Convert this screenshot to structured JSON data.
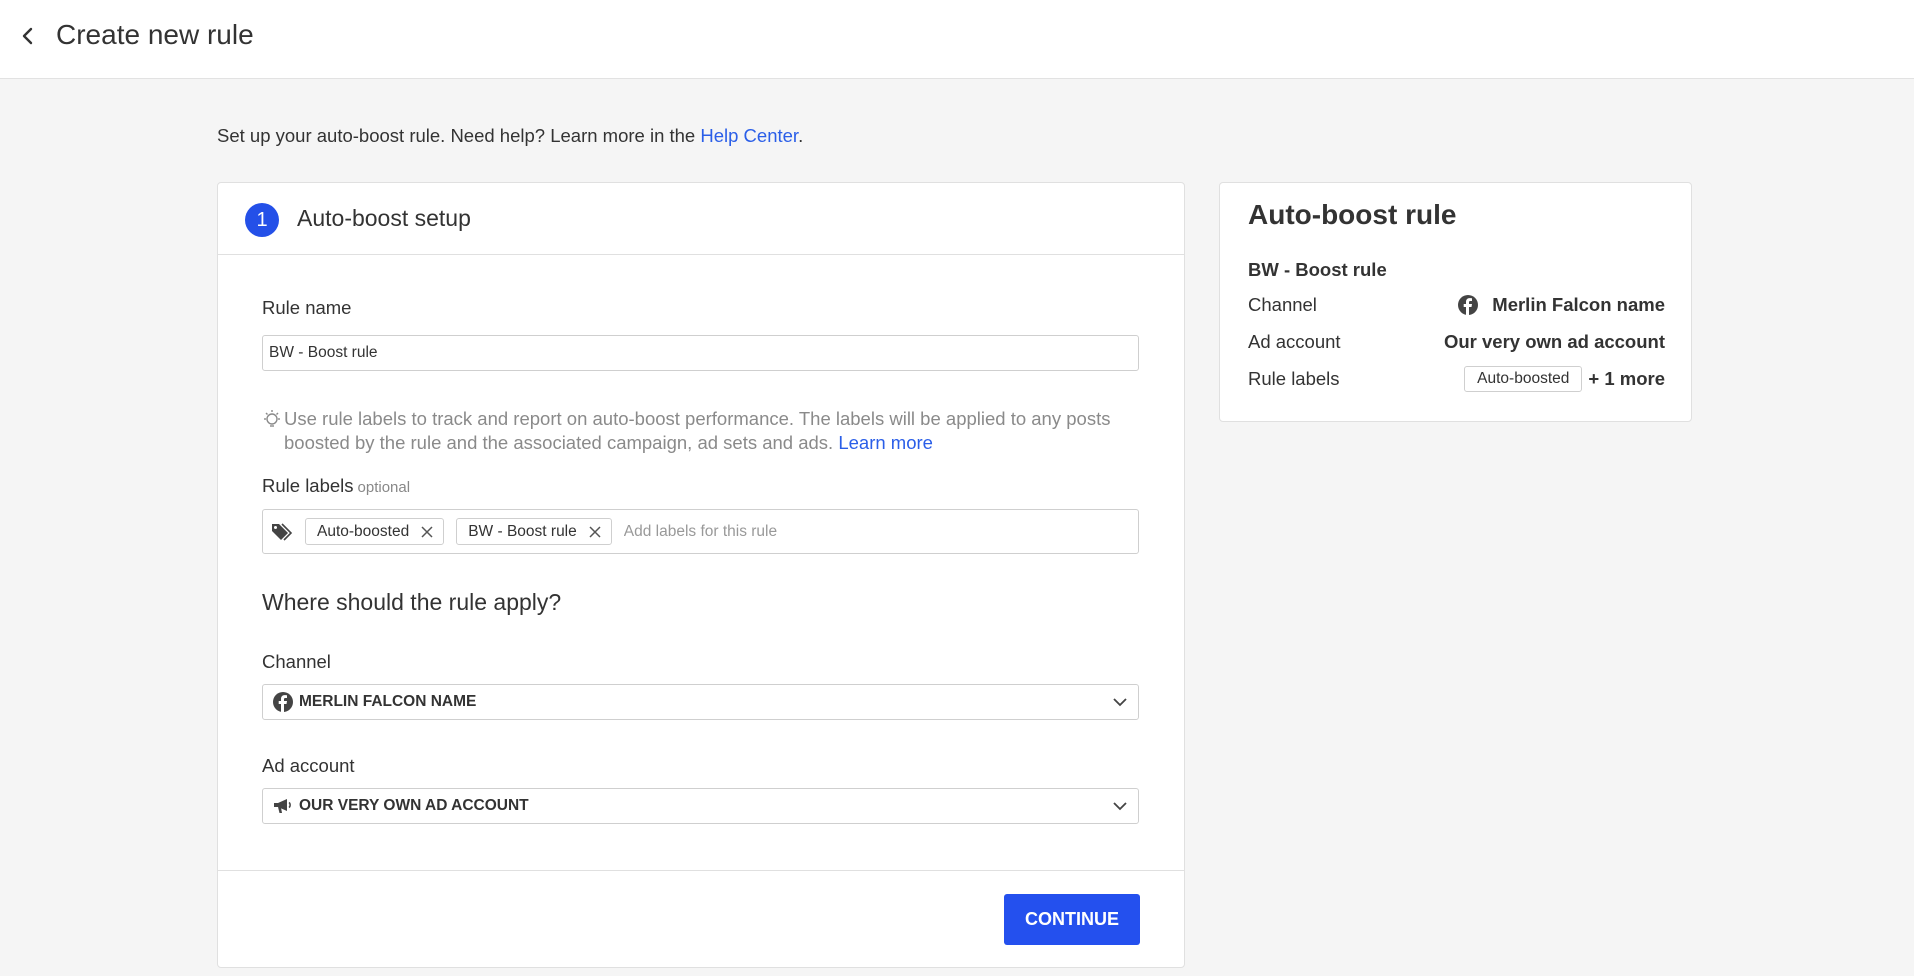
{
  "header": {
    "title": "Create new rule"
  },
  "intro": {
    "text": "Set up your auto-boost rule. Need help? Learn more in the ",
    "link": "Help Center",
    "end": "."
  },
  "setup_card": {
    "step": "1",
    "title": "Auto-boost setup",
    "rule_name_label": "Rule name",
    "rule_name_value": "BW - Boost rule",
    "hint_text": "Use rule labels to track and report on auto-boost performance. The labels will be applied to any posts boosted by the rule and the associated campaign, ad sets and ads. ",
    "hint_link": "Learn more",
    "labels_label": "Rule labels",
    "labels_optional": "optional",
    "labels": [
      "Auto-boosted",
      "BW - Boost rule"
    ],
    "labels_placeholder": "Add labels for this rule",
    "section_title": "Where should the rule apply?",
    "channel_label": "Channel",
    "channel_value": "MERLIN FALCON NAME",
    "channel_icon": "facebook-icon",
    "ad_account_label": "Ad account",
    "ad_account_value": "OUR VERY OWN AD ACCOUNT",
    "ad_account_icon": "megaphone-icon",
    "continue_label": "CONTINUE",
    "accent_color": "#2450ee"
  },
  "summary": {
    "title": "Auto-boost rule",
    "rule_name": "BW - Boost rule",
    "channel_label": "Channel",
    "channel_value": "Merlin Falcon name",
    "ad_account_label": "Ad account",
    "ad_account_value": "Our very own ad account",
    "labels_label": "Rule labels",
    "labels_chip": "Auto-boosted",
    "labels_more": "+ 1 more"
  }
}
